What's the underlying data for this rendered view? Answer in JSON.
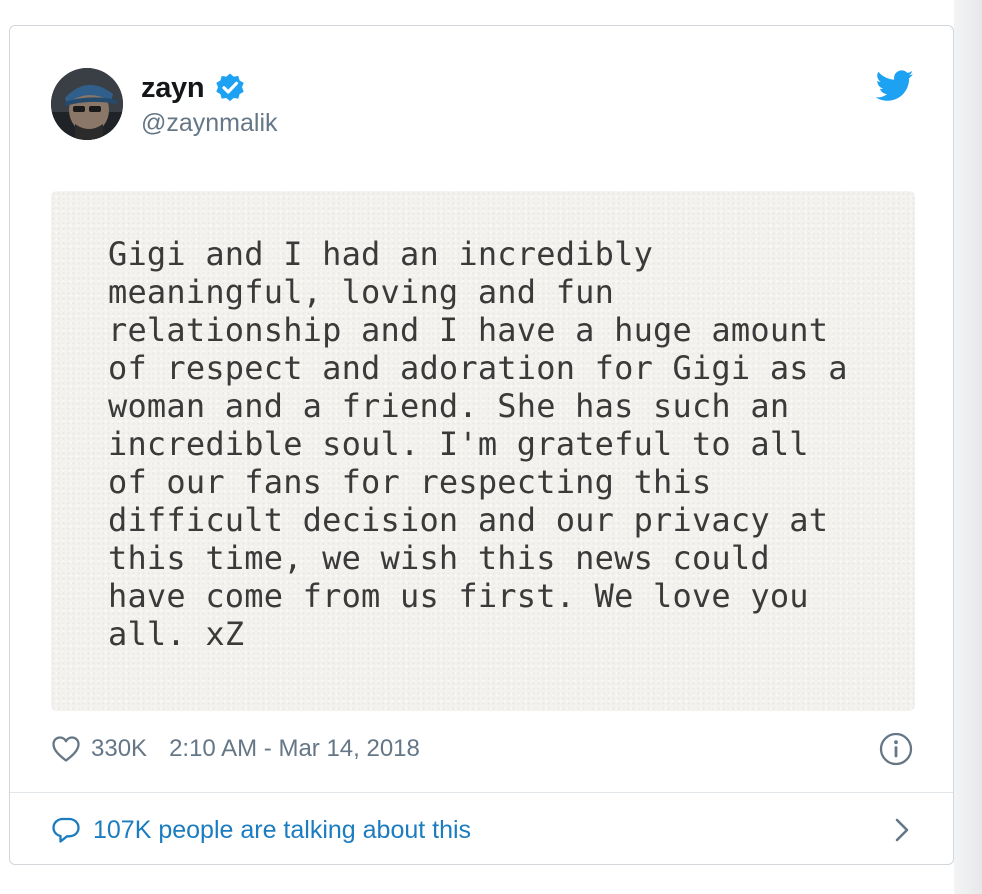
{
  "user": {
    "display_name": "zayn",
    "handle": "@zaynmalik",
    "verified": true
  },
  "tweet": {
    "image_text": "Gigi and I had an incredibly\nmeaningful, loving and fun\nrelationship and I have a huge amount\nof respect and adoration for Gigi as a\nwoman and a friend. She has such an\nincredible soul. I'm grateful to all\nof our fans for respecting this\ndifficult decision and our privacy at\nthis time, we wish this news could\nhave come from us first. We love you\nall. xZ"
  },
  "meta": {
    "likes": "330K",
    "timestamp": "2:10 AM - Mar 14, 2018"
  },
  "conversation": {
    "label": "107K people are talking about this"
  },
  "icons": {
    "verified": "verified-badge-icon",
    "brand": "twitter-bird-icon",
    "like": "heart-icon",
    "info": "info-icon",
    "reply": "speech-bubble-icon",
    "chevron": "chevron-right-icon"
  },
  "colors": {
    "brand_blue": "#1da1f2",
    "link_blue": "#1b7cc0",
    "muted_text": "#657786",
    "name_text": "#14171a"
  }
}
